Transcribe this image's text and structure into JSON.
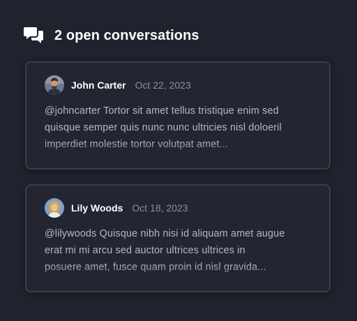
{
  "header": {
    "icon": "chat-bubbles-icon",
    "title": "2 open conversations"
  },
  "conversations": [
    {
      "name": "John Carter",
      "date": "Oct 22, 2023",
      "avatar": "avatar-photo-john-carter",
      "message": "@johncarter Tortor sit amet tellus tristique enim sed\nquisque semper quis nunc nunc ultricies nisl doloeril\nimperdiet molestie tortor volutpat amet..."
    },
    {
      "name": "Lily Woods",
      "date": "Oct 18, 2023",
      "avatar": "avatar-photo-lily-woods",
      "message": "@lilywoods Quisque nibh nisi id aliquam amet augue\nerat mi mi arcu sed auctor ultrices ultrices in\nposuere amet, fusce quam proin id nisl gravida..."
    }
  ],
  "colors": {
    "background": "#20232d",
    "card": "#232632",
    "border": "#3a3e4a",
    "text_primary": "#ffffff",
    "text_secondary": "#b4b8c2",
    "text_muted": "#8c909c"
  }
}
